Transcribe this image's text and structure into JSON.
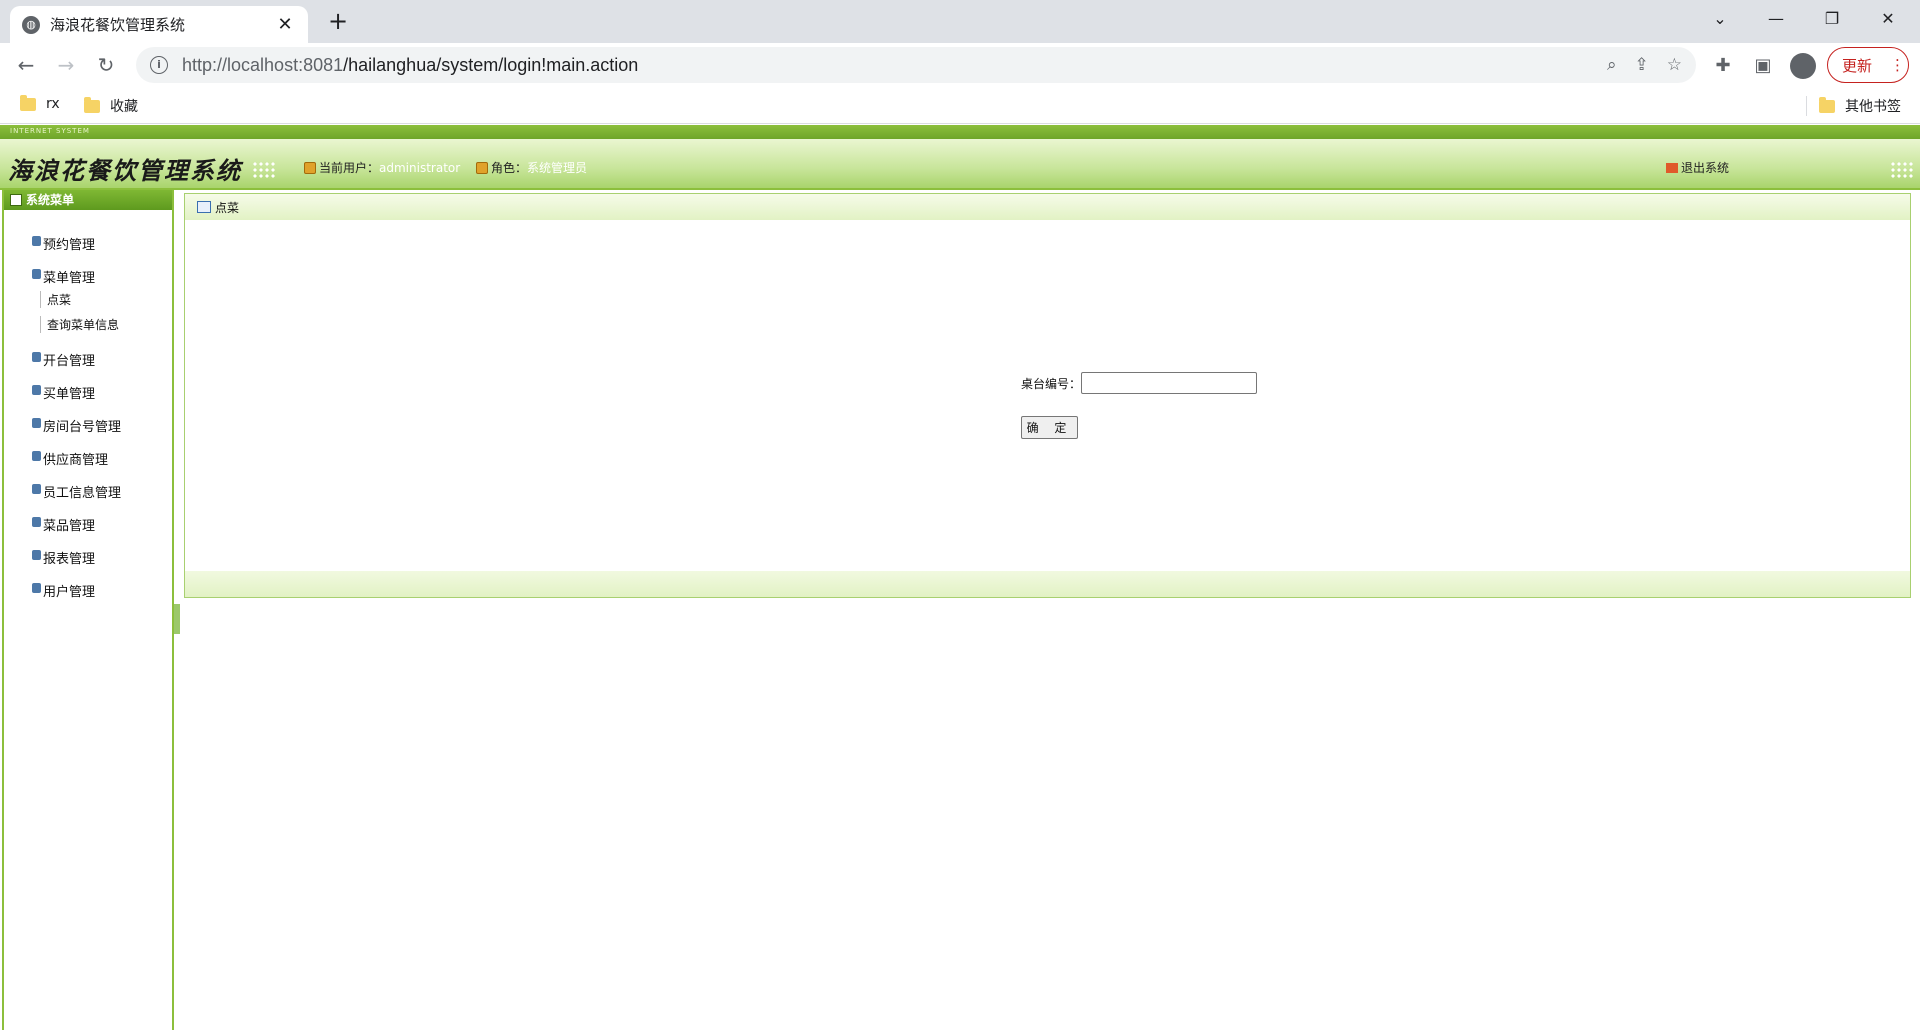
{
  "browser": {
    "tab_title": "海浪花餐饮管理系统",
    "tab_close": "✕",
    "new_tab": "+",
    "url_host": "http://localhost:8081",
    "url_path": "/hailanghua/system/login!main.action",
    "update_label": "更新",
    "bookmarks": [
      {
        "label": "rx"
      },
      {
        "label": "收藏"
      }
    ],
    "other_bookmarks": "其他书签"
  },
  "app": {
    "top_tag": "INTERNET SYSTEM",
    "title": "海浪花餐饮管理系统",
    "current_user_label": "当前用户：",
    "current_user": "administrator",
    "role_label": "角色：",
    "role": "系统管理员",
    "logout": "退出系统"
  },
  "sidebar": {
    "header": "系统菜单",
    "items": [
      {
        "label": "预约管理"
      },
      {
        "label": "菜单管理"
      },
      {
        "label": "开台管理"
      },
      {
        "label": "买单管理"
      },
      {
        "label": "房间台号管理"
      },
      {
        "label": "供应商管理"
      },
      {
        "label": "员工信息管理"
      },
      {
        "label": "菜品管理"
      },
      {
        "label": "报表管理"
      },
      {
        "label": "用户管理"
      }
    ],
    "submenu": [
      {
        "label": "点菜"
      },
      {
        "label": "查询菜单信息"
      }
    ]
  },
  "main": {
    "panel_title": "点菜",
    "table_no_label": "桌台编号：",
    "table_no_value": "",
    "confirm_label": "确 定"
  }
}
